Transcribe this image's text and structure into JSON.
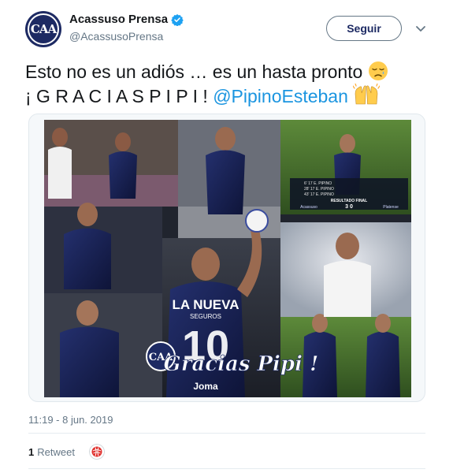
{
  "account": {
    "display_name": "Acassuso Prensa",
    "handle": "@AcassusoPrensa",
    "avatar_letters": "CAA"
  },
  "follow_button": {
    "label": "Seguir"
  },
  "tweet": {
    "line1": "Esto no es un adiós … es un hasta pronto",
    "line2_text": "¡ G R A C I A S  P I P I ! ",
    "line2_mention": "@PipinoEsteban"
  },
  "media": {
    "overlay_text": "Gracias Pipi !",
    "jersey_sponsor": "LA NUEVA",
    "jersey_sponsor_sub": "SEGUROS",
    "jersey_number": "10",
    "jersey_brand": "Joma",
    "scoreboard_title": "RESULTADO FINAL",
    "scoreboard_score": "3  0",
    "scoreboard_home": "Acassuso",
    "scoreboard_away": "Platense",
    "scorers": [
      "6' 17 E. PIPINO",
      "28' 17 E. PIPINO",
      "43' 17 E. PIPINO"
    ]
  },
  "timestamp": "11:19 - 8 jun. 2019",
  "stats": {
    "retweets_count": "1",
    "retweets_label": "Retweet"
  },
  "colors": {
    "brand_navy": "#1d2a63",
    "link_blue": "#1b95e0",
    "verified_blue": "#1da1f2"
  },
  "icons": [
    "verified-badge-icon",
    "chevron-down-icon",
    "sad-face-emoji",
    "raised-hands-emoji"
  ]
}
